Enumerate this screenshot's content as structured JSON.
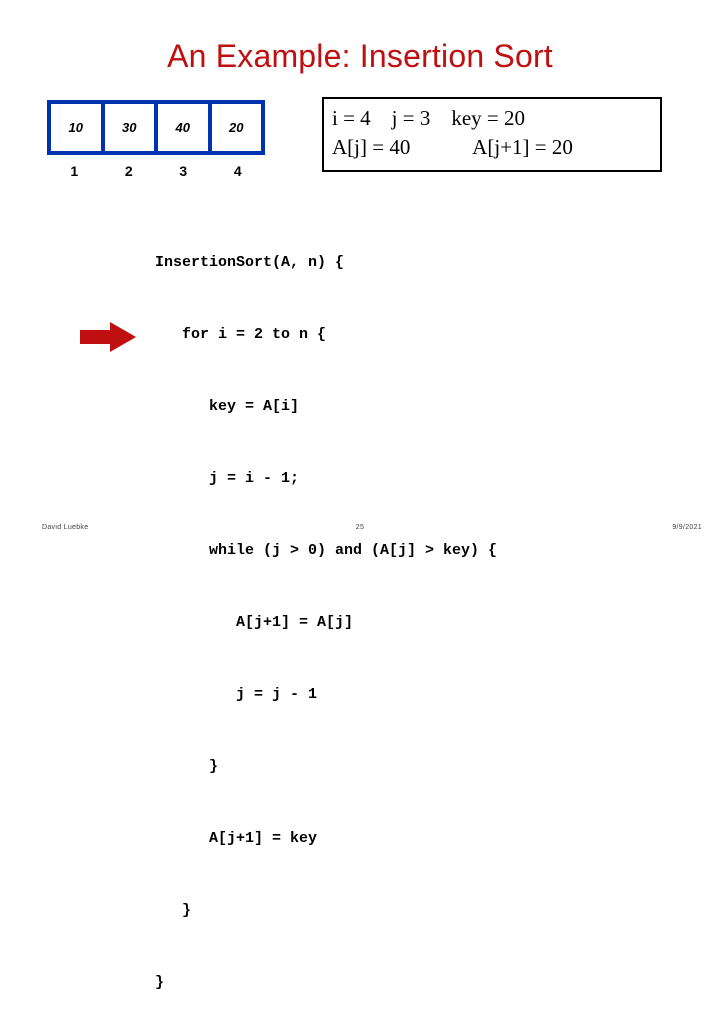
{
  "slide": {
    "title": "An Example: Insertion Sort"
  },
  "array": {
    "values": [
      "10",
      "30",
      "40",
      "20"
    ],
    "indices": [
      "1",
      "2",
      "3",
      "4"
    ],
    "border_color": "#0033B0"
  },
  "state_box": {
    "line1": "i = 4    j = 3    key = 20",
    "line2": "A[j] = 40            A[j+1] = 20",
    "border_color": "#000000"
  },
  "code": {
    "lines": [
      "InsertionSort(A, n) {",
      "   for i = 2 to n {",
      "      key = A[i]",
      "      j = i - 1;",
      "      while (j > 0) and (A[j] > key) {",
      "         A[j+1] = A[j]",
      "         j = j - 1",
      "      }",
      "      A[j+1] = key",
      "   }",
      "}"
    ]
  },
  "arrow": {
    "name": "current-step-arrow",
    "color": "#BF0F10",
    "direction": "right"
  },
  "footer": {
    "author": "David Luebke",
    "page": "25",
    "date": "9/9/2021"
  },
  "colors": {
    "title_red": "#BF0F10",
    "array_blue": "#0033B0",
    "text_black": "#000000"
  }
}
